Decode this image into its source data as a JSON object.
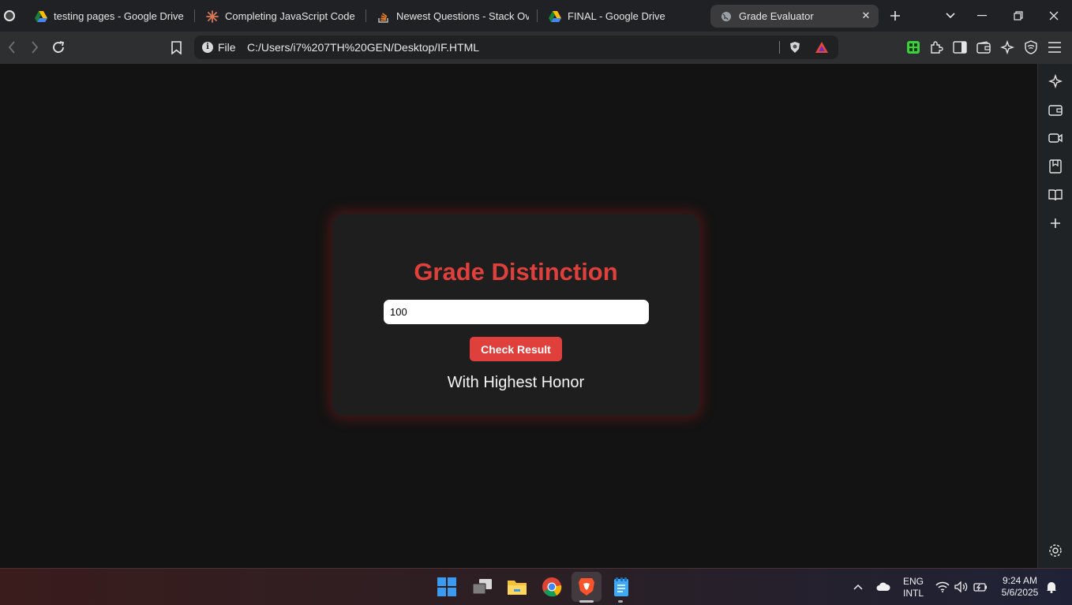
{
  "tabs": [
    {
      "title": "testing pages - Google Drive",
      "icon": "google-drive-icon"
    },
    {
      "title": "Completing JavaScript Code for",
      "icon": "claude-icon"
    },
    {
      "title": "Newest Questions - Stack Overf",
      "icon": "stackoverflow-icon"
    },
    {
      "title": "FINAL - Google Drive",
      "icon": "google-drive-icon"
    },
    {
      "title": "Grade Evaluator",
      "icon": "globe-icon",
      "active": true
    }
  ],
  "address_bar": {
    "scheme_label": "File",
    "url": "C:/Users/i7%207TH%20GEN/Desktop/IF.HTML"
  },
  "page": {
    "title": "Grade Distinction",
    "input_value": "100",
    "button_label": "Check Result",
    "result": "With Highest Honor"
  },
  "taskbar": {
    "language": "ENG",
    "layout": "INTL",
    "time": "9:24 AM",
    "date": "5/6/2025"
  },
  "colors": {
    "accent": "#e0403c",
    "page_background": "#131313",
    "card_background": "#1e1e1e"
  }
}
